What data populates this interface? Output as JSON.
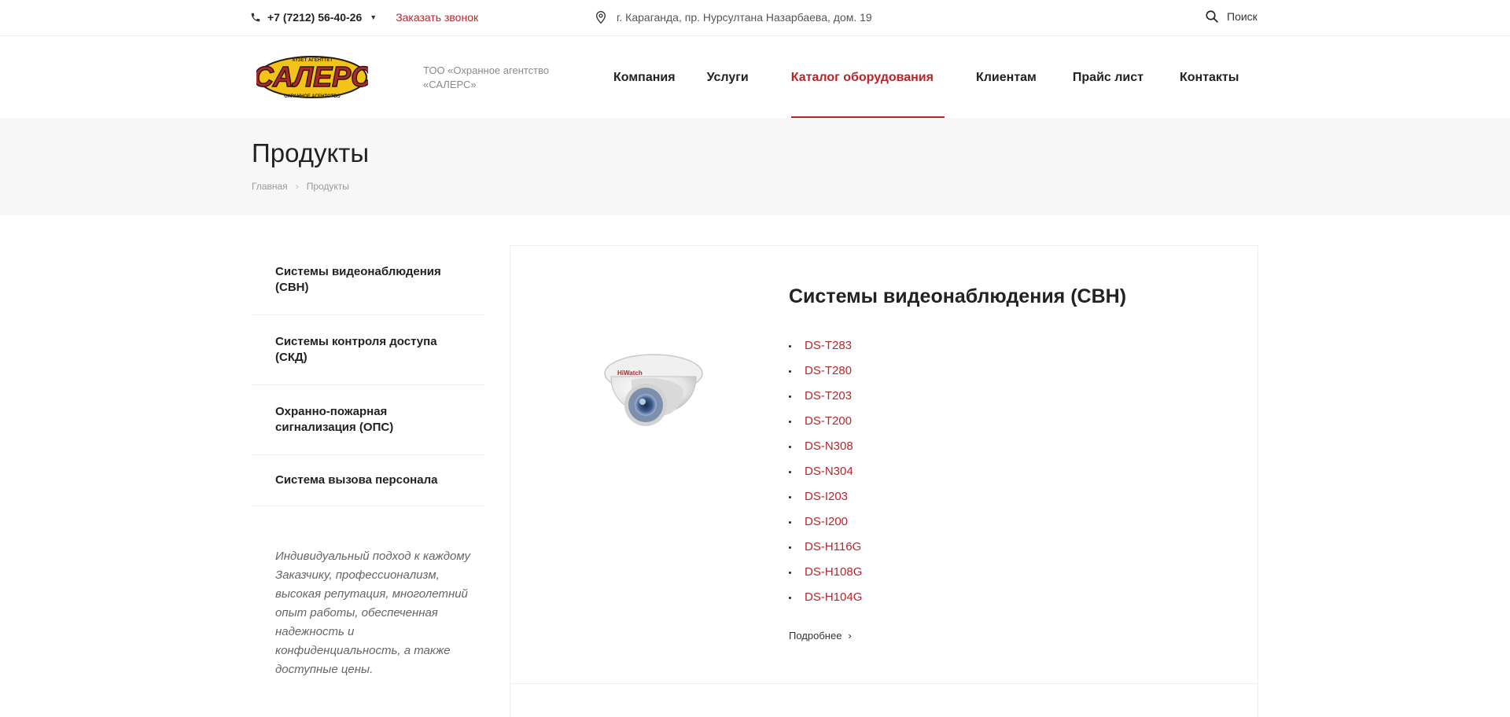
{
  "topbar": {
    "phone": "+7 (7212) 56-40-26",
    "callback": "Заказать звонок",
    "address": "г. Караганда, пр. Нурсултана Назарбаева, дом. 19",
    "search": "Поиск"
  },
  "header": {
    "logo": {
      "main_text": "САЛЕРС",
      "top_text": "КҮЗЕТ АГЕНТТІГІ",
      "bottom_text": "ОХРАННОЕ АГЕНТСТВО"
    },
    "company_desc": "ТОО «Охранное агентство «САЛЕРС»",
    "nav": [
      {
        "label": "Компания"
      },
      {
        "label": "Услуги"
      },
      {
        "label": "Каталог оборудования"
      },
      {
        "label": "Клиентам"
      },
      {
        "label": "Прайс лист"
      },
      {
        "label": "Контакты"
      }
    ]
  },
  "page": {
    "title": "Продукты",
    "breadcrumb": [
      "Главная",
      "Продукты"
    ],
    "breadcrumb_sep": "›"
  },
  "sidebar": {
    "items": [
      {
        "label": "Системы видеонаблюдения (СВН)"
      },
      {
        "label": "Системы контроля доступа (СКД)"
      },
      {
        "label": "Охранно-пожарная сигнализация (ОПС)"
      },
      {
        "label": "Система вызова персонала"
      }
    ],
    "quote": "Индивидуальный подход к каждому Заказчику, профессионализм, высокая репутация, многолетний опыт работы, обеспеченная надежность и конфиденциальность, а также доступные цены."
  },
  "category": {
    "title": "Системы видеонаблюдения (СВН)",
    "image_brand": "HiWatch",
    "models": [
      "DS-T283",
      "DS-T280",
      "DS-T203",
      "DS-T200",
      "DS-N308",
      "DS-N304",
      "DS-I203",
      "DS-I200",
      "DS-H116G",
      "DS-H108G",
      "DS-H104G"
    ],
    "more": "Подробнее",
    "more_arrow": "›"
  },
  "colors": {
    "accent": "#b5262b",
    "band": "#f7f7f7",
    "text": "#222222",
    "muted": "#999999"
  },
  "icons": {
    "phone": "phone-icon",
    "location": "map-pin-icon",
    "search": "search-icon",
    "caret": "caret-down-icon"
  }
}
